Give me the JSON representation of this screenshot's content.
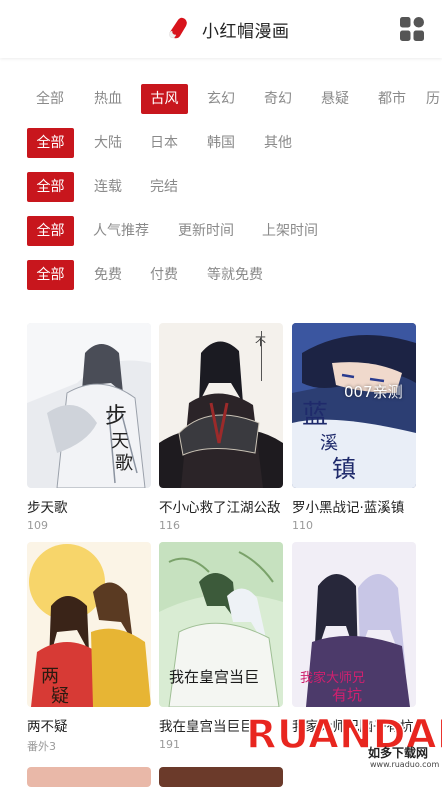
{
  "header": {
    "title": "小红帽漫画"
  },
  "filters": {
    "genres": [
      "全部",
      "热血",
      "古风",
      "玄幻",
      "奇幻",
      "悬疑",
      "都市",
      "历"
    ],
    "regions": [
      "全部",
      "大陆",
      "日本",
      "韩国",
      "其他"
    ],
    "status": [
      "全部",
      "连载",
      "完结"
    ],
    "sort": [
      "全部",
      "人气推荐",
      "更新时间",
      "上架时间"
    ],
    "price": [
      "全部",
      "免费",
      "付费",
      "等就免费"
    ]
  },
  "comics": [
    {
      "title": "步天歌",
      "sub": "109"
    },
    {
      "title": "不小心救了江湖公敌",
      "sub": "116"
    },
    {
      "title": "罗小黑战记·蓝溪镇",
      "sub": "110",
      "overlay": "007亲测"
    },
    {
      "title": "两不疑",
      "sub": "番外3"
    },
    {
      "title": "我在皇宫当巨巨",
      "sub": "191"
    },
    {
      "title": "我家大师兄脑子有坑",
      "sub": ""
    }
  ],
  "watermark": {
    "brand": "RUANDADO",
    "sub": "如多下载网",
    "url": "www.ruaduo.com"
  },
  "colors": {
    "accent": "#c8161d",
    "inactive": "#8a8a8a"
  }
}
